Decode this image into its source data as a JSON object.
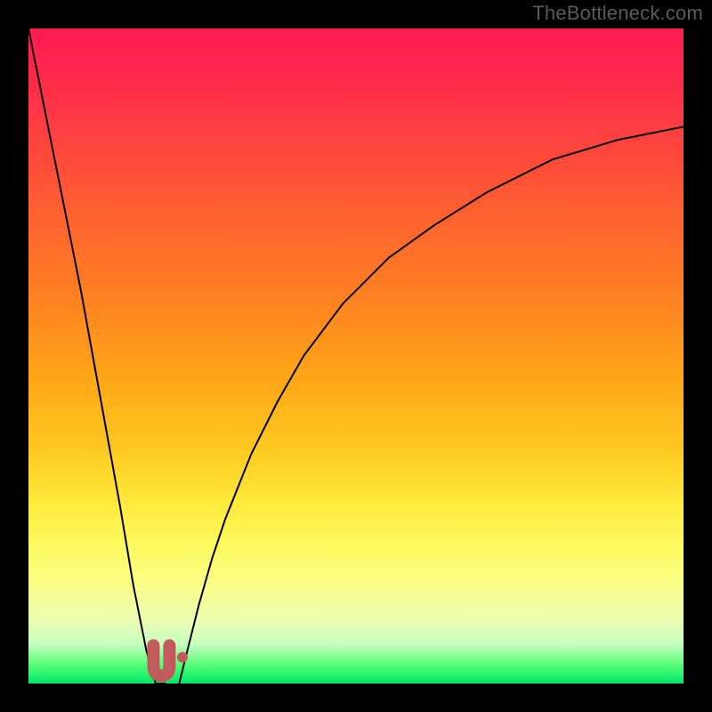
{
  "watermark": "TheBottleneck.com",
  "colors": {
    "frame": "#000000",
    "curve": "#000000",
    "marker": "#c15a5a",
    "gradient_top": "#ff1a52",
    "gradient_bottom": "#00e86a"
  },
  "chart_data": {
    "type": "line",
    "title": "",
    "xlabel": "",
    "ylabel": "",
    "xlim": [
      0,
      100
    ],
    "ylim": [
      0,
      100
    ],
    "grid": false,
    "legend": false,
    "series": [
      {
        "name": "left-curve",
        "x": [
          0,
          2,
          4,
          6,
          8,
          10,
          12,
          14,
          16,
          18,
          19.4,
          20,
          21
        ],
        "y": [
          100,
          90,
          80,
          70,
          60,
          49,
          38,
          27,
          15,
          5,
          0,
          0,
          0
        ]
      },
      {
        "name": "right-curve",
        "x": [
          23,
          24,
          26,
          28,
          30,
          34,
          38,
          42,
          48,
          55,
          62,
          70,
          80,
          90,
          100
        ],
        "y": [
          0,
          4,
          12,
          19,
          25,
          35,
          43,
          50,
          58,
          65,
          70,
          75,
          80,
          83,
          85
        ]
      }
    ],
    "markers": [
      {
        "name": "u-shape",
        "x_center": 20.3,
        "y_center": 2.0
      },
      {
        "name": "dot",
        "x": 23.5,
        "y": 4.0
      }
    ]
  }
}
